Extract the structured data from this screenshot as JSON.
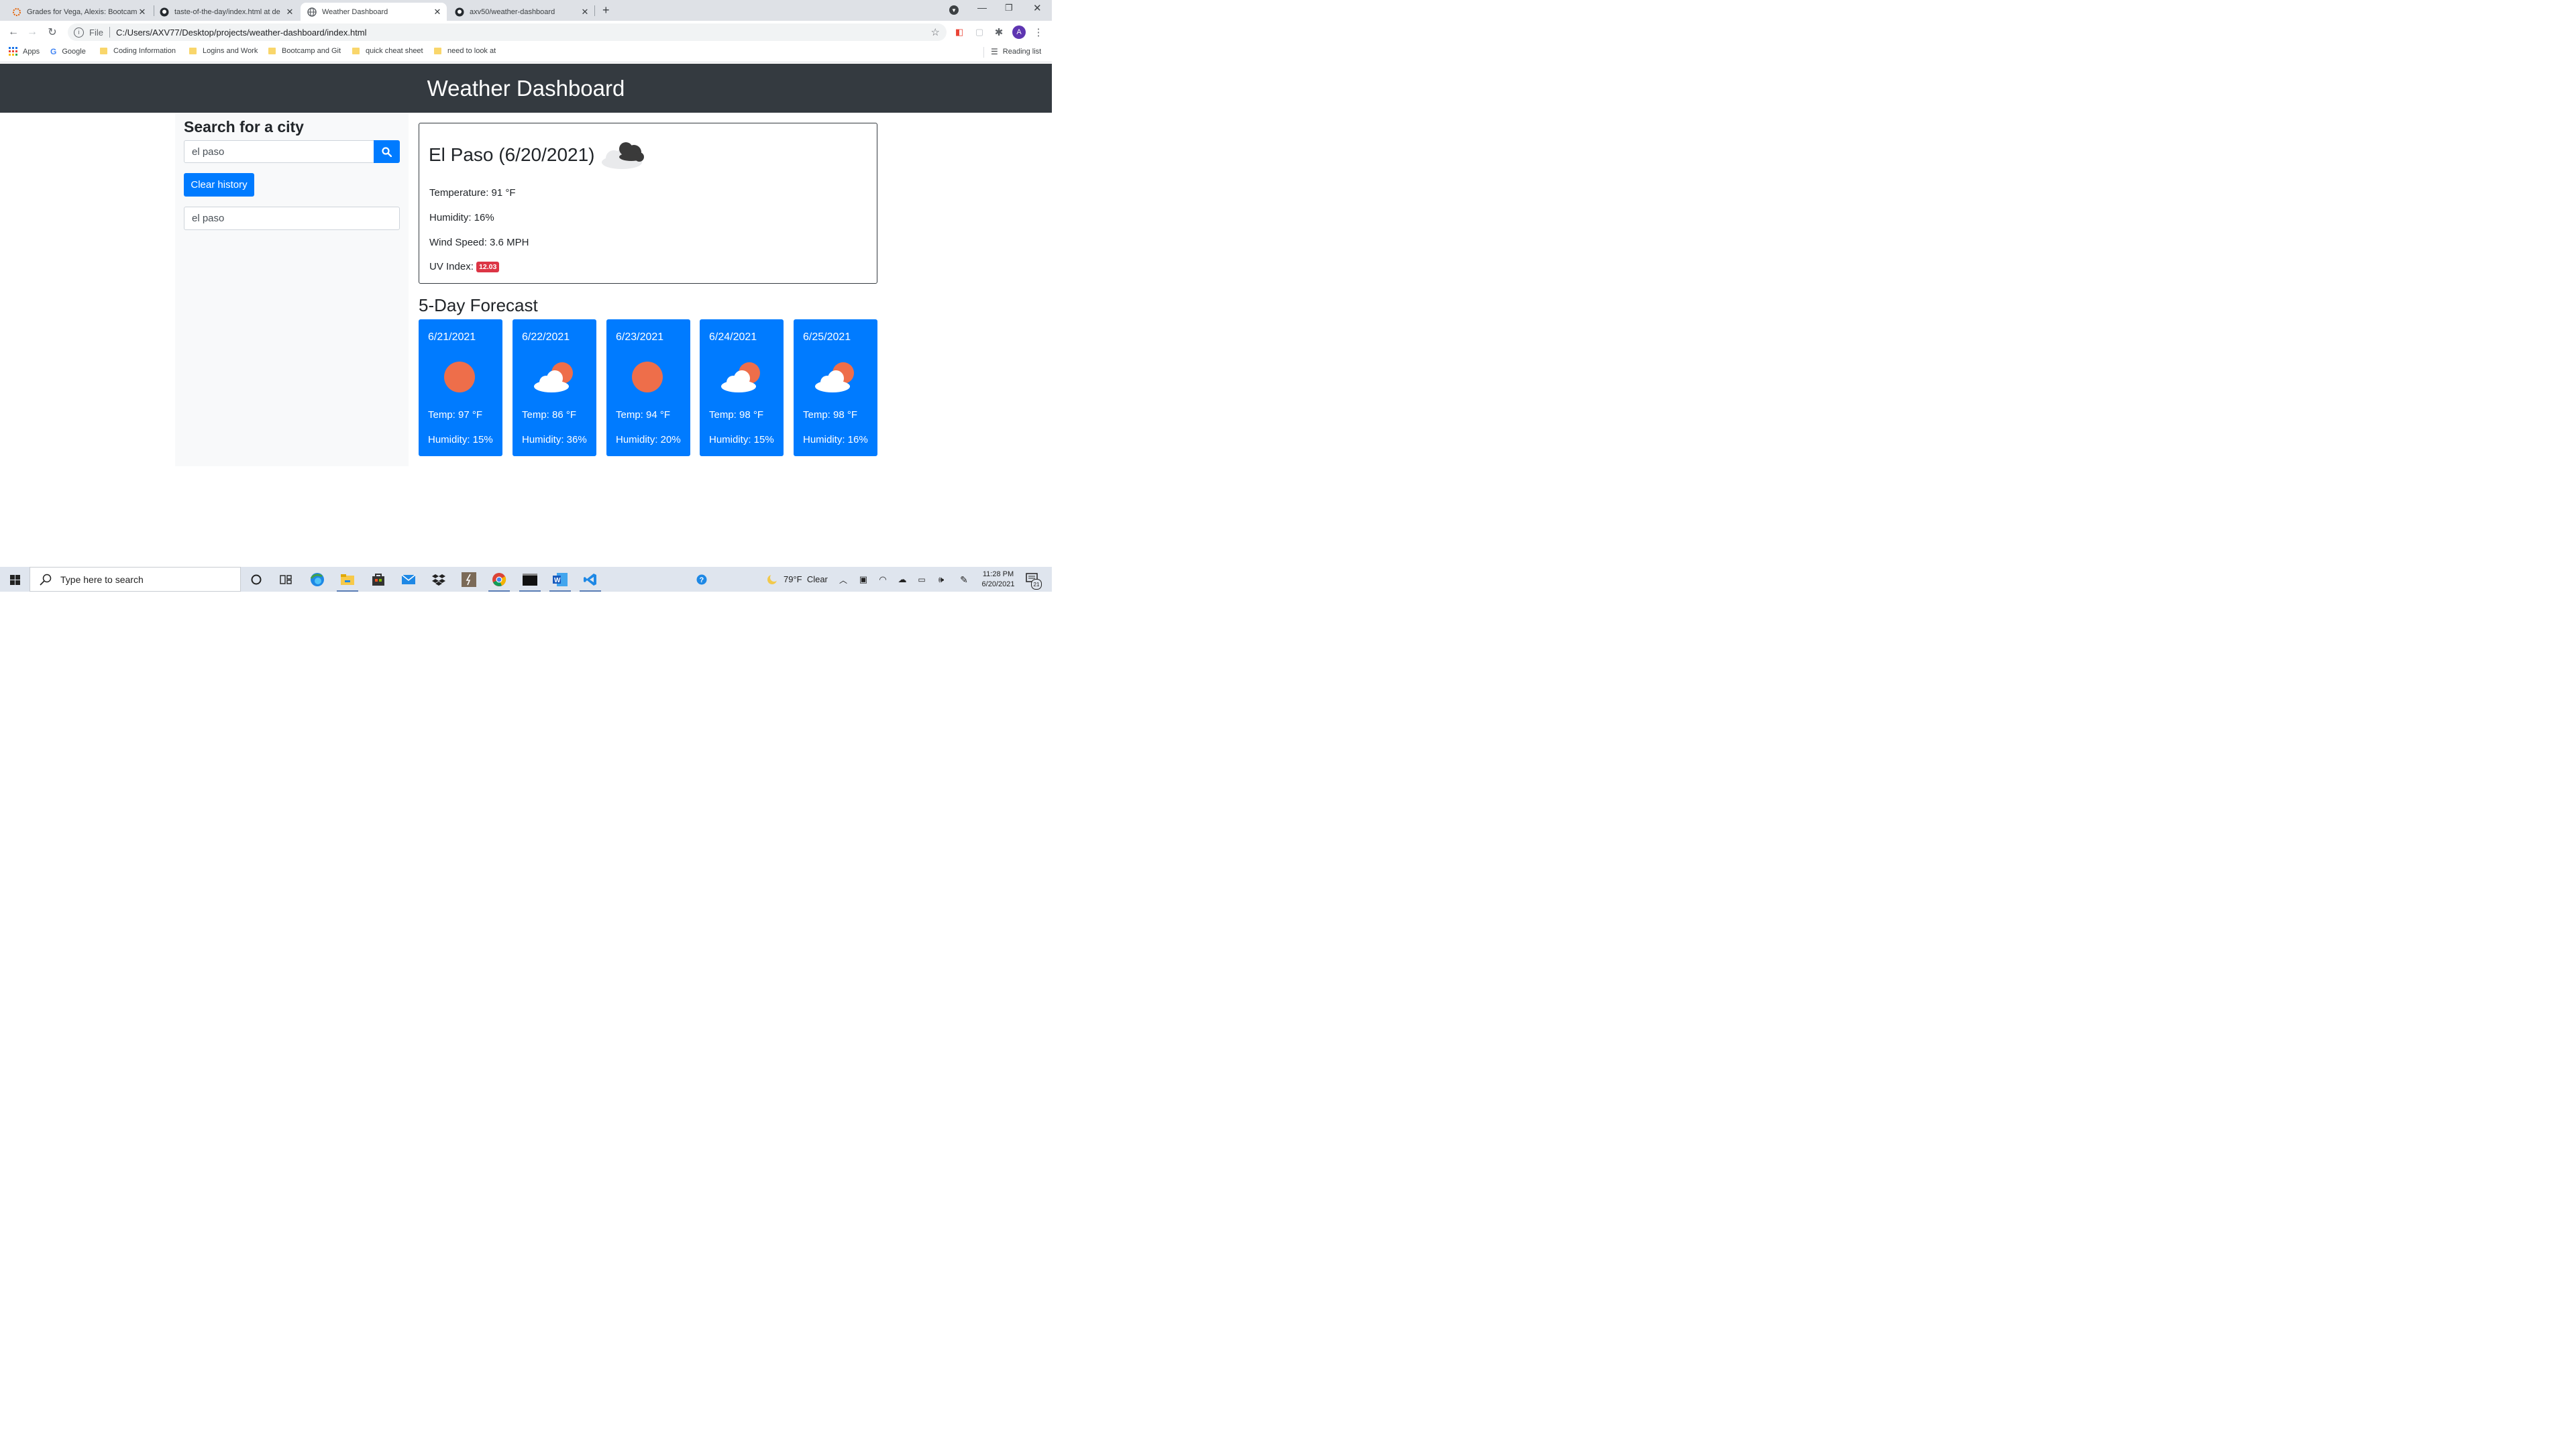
{
  "browser": {
    "tabs": [
      {
        "title": "Grades for Vega, Alexis: Bootcamp",
        "active": false,
        "icon": "canvas-icon"
      },
      {
        "title": "taste-of-the-day/index.html at de",
        "active": false,
        "icon": "github-icon"
      },
      {
        "title": "Weather Dashboard",
        "active": true,
        "icon": "globe-icon"
      },
      {
        "title": "axv50/weather-dashboard",
        "active": false,
        "icon": "github-icon"
      }
    ],
    "file_label": "File",
    "url": "C:/Users/AXV77/Desktop/projects/weather-dashboard/index.html",
    "profile_initial": "A",
    "bookmarks": [
      "Apps",
      "Google",
      "Coding Information",
      "Logins and Work",
      "Bootcamp and Git",
      "quick cheat sheet",
      "need to look at"
    ],
    "reading_list": "Reading list"
  },
  "page": {
    "header_title": "Weather Dashboard",
    "search": {
      "heading": "Search for a city",
      "input_value": "el paso",
      "clear_label": "Clear history",
      "history": [
        "el paso"
      ]
    },
    "current": {
      "title": "El Paso (6/20/2021)",
      "temperature": "Temperature: 91 °F",
      "humidity": "Humidity: 16%",
      "wind": "Wind Speed: 3.6 MPH",
      "uv_label": "UV Index:",
      "uv_value": "12.03",
      "uv_color": "#dc3545",
      "icon": "broken-clouds-icon"
    },
    "forecast": {
      "heading": "5-Day Forecast",
      "days": [
        {
          "date": "6/21/2021",
          "icon": "clear-sun-icon",
          "temp": "Temp: 97 °F",
          "humidity": "Humidity: 15%"
        },
        {
          "date": "6/22/2021",
          "icon": "few-clouds-icon",
          "temp": "Temp: 86 °F",
          "humidity": "Humidity: 36%"
        },
        {
          "date": "6/23/2021",
          "icon": "clear-sun-icon",
          "temp": "Temp: 94 °F",
          "humidity": "Humidity: 20%"
        },
        {
          "date": "6/24/2021",
          "icon": "few-clouds-icon",
          "temp": "Temp: 98 °F",
          "humidity": "Humidity: 15%"
        },
        {
          "date": "6/25/2021",
          "icon": "few-clouds-icon",
          "temp": "Temp: 98 °F",
          "humidity": "Humidity: 16%"
        }
      ],
      "card_color": "#007bff"
    }
  },
  "taskbar": {
    "search_placeholder": "Type here to search",
    "weather": "79°F  Clear",
    "time": "11:28 PM",
    "date": "6/20/2021",
    "notifications": "21"
  }
}
